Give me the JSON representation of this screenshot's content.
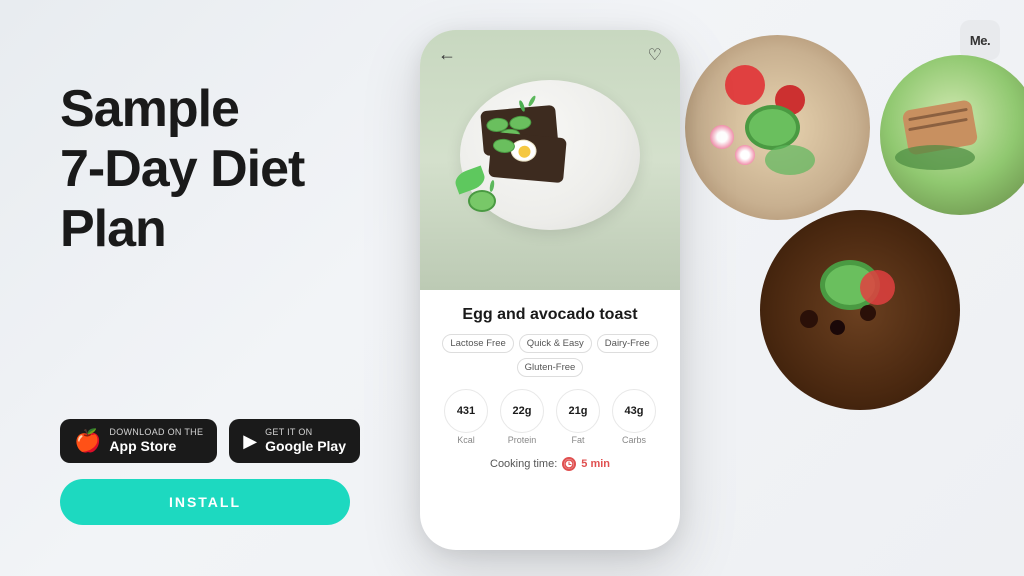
{
  "app": {
    "logo": "Me.",
    "bg_color": "#f0f2f5"
  },
  "left": {
    "title_line1": "Sample",
    "title_line2": "7-Day Diet",
    "title_line3": "Plan"
  },
  "store_buttons": {
    "appstore": {
      "small_text": "Download on the",
      "name": "App Store",
      "icon": "🍎"
    },
    "googleplay": {
      "small_text": "GET IT ON",
      "name": "Google Play",
      "icon": "▶"
    }
  },
  "install_button": {
    "label": "INSTALL"
  },
  "phone": {
    "recipe_title": "Egg and avocado toast",
    "tags": [
      "Lactose Free",
      "Quick & Easy",
      "Dairy-Free",
      "Gluten-Free"
    ],
    "nutrition": [
      {
        "value": "431",
        "label": "Kcal"
      },
      {
        "value": "22g",
        "label": "Protein"
      },
      {
        "value": "21g",
        "label": "Fat"
      },
      {
        "value": "43g",
        "label": "Carbs"
      }
    ],
    "cooking_time_label": "Cooking time:",
    "cooking_time_value": "5 min"
  }
}
